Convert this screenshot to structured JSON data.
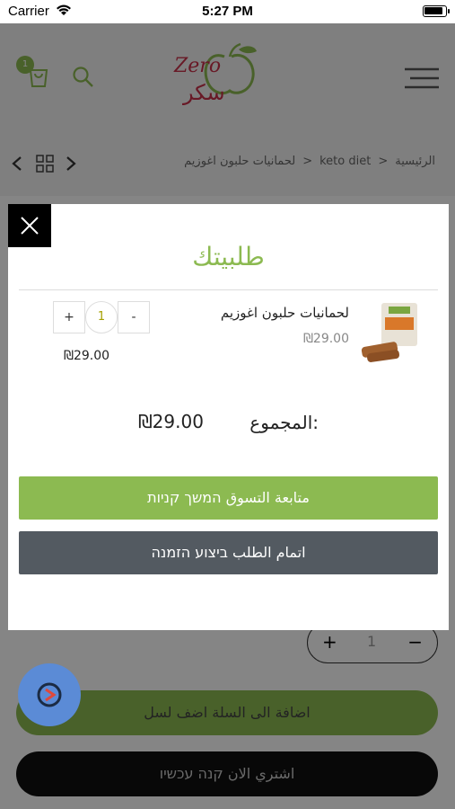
{
  "status_bar": {
    "carrier": "Carrier",
    "time": "5:27 PM"
  },
  "header": {
    "cart_count": "1",
    "logo_text_latin": "Zero",
    "logo_text_arabic": "سكر"
  },
  "breadcrumb": {
    "home": "الرئيسية",
    "separator": "<",
    "category": "keto diet",
    "current": "لحمانيات حلبون اغوزيم"
  },
  "background_page": {
    "quantity": "1",
    "add_to_cart_label": "اضافة الى السلة اضف لسل",
    "buy_now_label": "اشتري الان קנה עכשיו"
  },
  "modal": {
    "title": "طلبيتك",
    "item": {
      "name": "لحمانيات حلبون اغوزيم",
      "price": "₪29.00",
      "quantity": "1",
      "quantity_plus": "+",
      "quantity_minus": "-",
      "line_total": "₪29.00"
    },
    "total_label": "المجموع:",
    "total_value": "₪29.00",
    "continue_shopping_label": "متابعة التسوق המשך קניות",
    "checkout_label": "اتمام الطلب ביצוע הזמנה"
  },
  "colors": {
    "accent_green": "#8cba51",
    "checkout_gray": "#535a61",
    "logo_red": "#c8304a"
  },
  "icons": [
    "wifi-icon",
    "battery-icon",
    "cart-icon",
    "search-icon",
    "menu-icon",
    "chevron-left-icon",
    "grid-icon",
    "chevron-right-icon",
    "close-icon",
    "chat-icon"
  ]
}
